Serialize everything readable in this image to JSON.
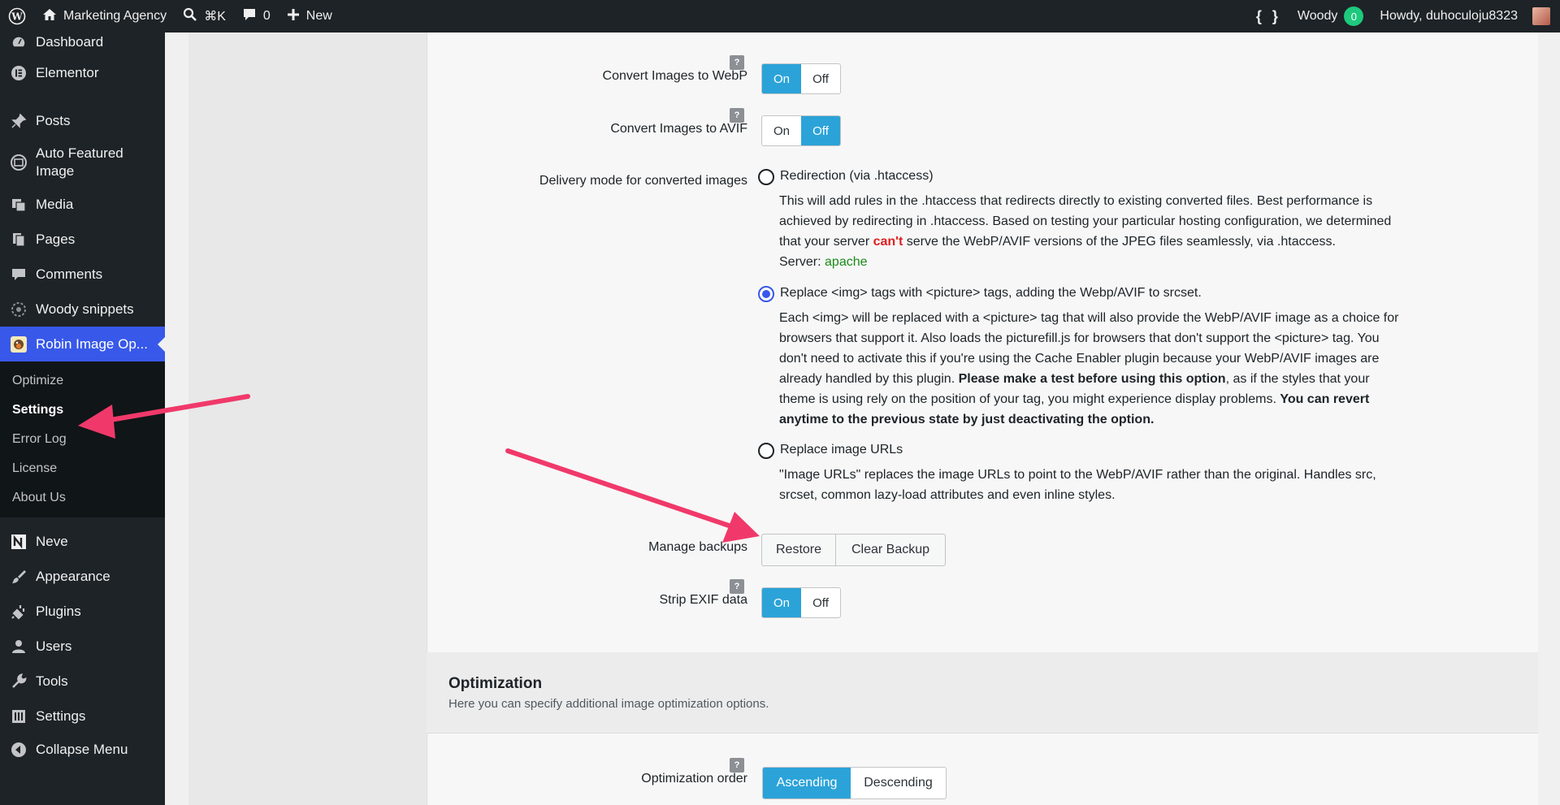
{
  "adminbar": {
    "site_name": "Marketing Agency",
    "search_shortcut": "⌘K",
    "comments_count": "0",
    "new_label": "New",
    "code_glyph": "{ }",
    "woody_label": "Woody",
    "woody_count": "0",
    "howdy": "Howdy, duhoculoju8323"
  },
  "sidebar": {
    "items": [
      {
        "label": "Dashboard",
        "icon": "dashboard-icon"
      },
      {
        "label": "Elementor",
        "icon": "elementor-icon"
      },
      {
        "label": "Posts",
        "icon": "pin-icon"
      },
      {
        "label": "Auto Featured Image",
        "icon": "auto-image-icon"
      },
      {
        "label": "Media",
        "icon": "media-icon"
      },
      {
        "label": "Pages",
        "icon": "pages-icon"
      },
      {
        "label": "Comments",
        "icon": "comment-icon"
      },
      {
        "label": "Woody snippets",
        "icon": "snippets-icon"
      },
      {
        "label": "Robin Image Op...",
        "icon": "robin-icon"
      },
      {
        "label": "Neve",
        "icon": "neve-icon"
      },
      {
        "label": "Appearance",
        "icon": "brush-icon"
      },
      {
        "label": "Plugins",
        "icon": "plugin-icon"
      },
      {
        "label": "Users",
        "icon": "user-icon"
      },
      {
        "label": "Tools",
        "icon": "wrench-icon"
      },
      {
        "label": "Settings",
        "icon": "settings-icon"
      },
      {
        "label": "Collapse Menu",
        "icon": "collapse-icon"
      }
    ],
    "submenu": [
      "Optimize",
      "Settings",
      "Error Log",
      "License",
      "About Us"
    ]
  },
  "settings": {
    "webp": {
      "label": "Convert Images to WebP",
      "on": "On",
      "off": "Off",
      "value": "On"
    },
    "avif": {
      "label": "Convert Images to AVIF",
      "on": "On",
      "off": "Off",
      "value": "Off"
    },
    "delivery": {
      "label": "Delivery mode for converted images",
      "opt1_title": "Redirection (via .htaccess)",
      "opt1_line1": "This will add rules in the .htaccess that redirects directly to existing converted files. Best performance is",
      "opt1_line2": "achieved by redirecting in .htaccess. Based on testing your particular hosting configuration, we determined",
      "opt1_line3a": "that your server ",
      "opt1_cant": "can't",
      "opt1_line3b": " serve the WebP/AVIF versions of the JPEG files seamlessly, via .htaccess.",
      "opt1_server_label": "Server: ",
      "opt1_server_value": "apache",
      "opt2_title": "Replace <img> tags with <picture> tags, adding the Webp/AVIF to srcset.",
      "opt2_line1": "Each <img> will be replaced with a <picture> tag that will also provide the WebP/AVIF image as a choice for",
      "opt2_line2": "browsers that support it. Also loads the picturefill.js for browsers that don't support the <picture> tag. You",
      "opt2_line3": "don't need to activate this if you're using the Cache Enabler plugin because your WebP/AVIF images are",
      "opt2_line4a": "already handled by this plugin. ",
      "opt2_line4b": "Please make a test before using this option",
      "opt2_line4c": ", as if the styles that your",
      "opt2_line5a": "theme is using rely on the position of your tag, you might experience display problems. ",
      "opt2_line5b": "You can revert",
      "opt2_line6": "anytime to the previous state by just deactivating the option.",
      "opt3_title": "Replace image URLs",
      "opt3_line1": "\"Image URLs\" replaces the image URLs to point to the WebP/AVIF rather than the original. Handles src,",
      "opt3_line2": "srcset, common lazy-load attributes and even inline styles.",
      "selected": "Replace <img> tags with <picture> tags, adding the Webp/AVIF to srcset."
    },
    "backups": {
      "label": "Manage backups",
      "restore": "Restore",
      "clear": "Clear Backup"
    },
    "exif": {
      "label": "Strip EXIF data",
      "on": "On",
      "off": "Off",
      "value": "On"
    },
    "help_glyph": "?"
  },
  "optimization": {
    "title": "Optimization",
    "subtitle": "Here you can specify additional image optimization options.",
    "order_label": "Optimization order",
    "ascending": "Ascending",
    "descending": "Descending",
    "value": "Ascending"
  },
  "colors": {
    "accent": "#2ba3d8",
    "current_menu": "#3858e9",
    "arrow": "#f0396a"
  }
}
